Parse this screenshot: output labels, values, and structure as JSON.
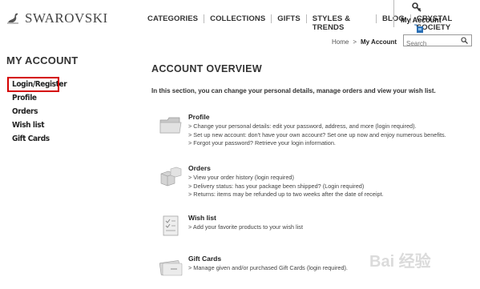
{
  "brand": {
    "name": "SWAROVSKI"
  },
  "topnav": [
    "CATEGORIES",
    "COLLECTIONS",
    "GIFTS",
    "STYLES & TRENDS",
    "BLOG",
    "CRYSTAL SOCIETY"
  ],
  "account_link": "My Account",
  "breadcrumb": {
    "home": "Home",
    "sep": ">",
    "current": "My Account"
  },
  "search": {
    "placeholder": "Search"
  },
  "sidebar": {
    "title": "MY ACCOUNT",
    "items": [
      "Login/Register",
      "Profile",
      "Orders",
      "Wish list",
      "Gift Cards"
    ]
  },
  "main": {
    "title": "ACCOUNT OVERVIEW",
    "intro": "In this section, you can change your personal details, manage orders and view your wish list.",
    "sections": [
      {
        "heading": "Profile",
        "icon": "folder-icon",
        "lines": [
          "Change your personal details: edit your password, address, and more (login required).",
          "Set up new account: don't have your own account? Set one up now and enjoy numerous benefits.",
          "Forgot your password? Retrieve your login information."
        ]
      },
      {
        "heading": "Orders",
        "icon": "boxes-icon",
        "lines": [
          "View your order history (login required)",
          "Delivery status: has your package been shipped? (Login required)",
          "Returns: items may be refunded up to two weeks after the date of receipt."
        ]
      },
      {
        "heading": "Wish list",
        "icon": "checklist-icon",
        "lines": [
          "Add your favorite products to your wish list"
        ]
      },
      {
        "heading": "Gift Cards",
        "icon": "gift-card-icon",
        "lines": [
          "Manage given and/or purchased Gift Cards (login required)."
        ]
      }
    ]
  },
  "watermark": "Bai 经验",
  "colors": {
    "highlight": "#d40000",
    "text": "#222222"
  }
}
